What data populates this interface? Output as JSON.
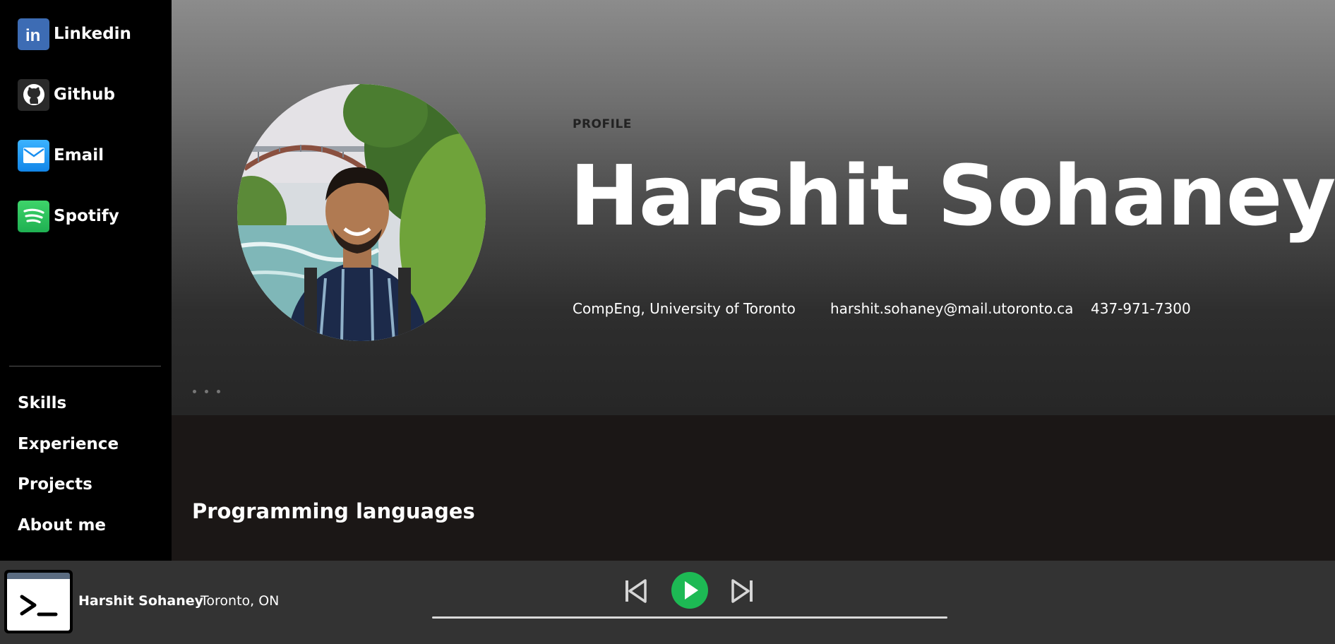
{
  "sidebar": {
    "socials": [
      {
        "label": "Linkedin",
        "icon": "linkedin-icon"
      },
      {
        "label": "Github",
        "icon": "github-icon"
      },
      {
        "label": "Email",
        "icon": "mail-icon"
      },
      {
        "label": "Spotify",
        "icon": "spotify-icon"
      }
    ],
    "nav": [
      "Skills",
      "Experience",
      "Projects",
      "About me"
    ]
  },
  "hero": {
    "eyebrow": "PROFILE",
    "name": "Harshit Sohaney",
    "school": "CompEng, University of Toronto",
    "email": "harshit.sohaney@mail.utoronto.ca",
    "phone": "437-971-7300"
  },
  "content": {
    "section_title": "Programming languages"
  },
  "player": {
    "name": "Harshit Sohaney",
    "location": "Toronto, ON",
    "play_color": "#1db954"
  }
}
